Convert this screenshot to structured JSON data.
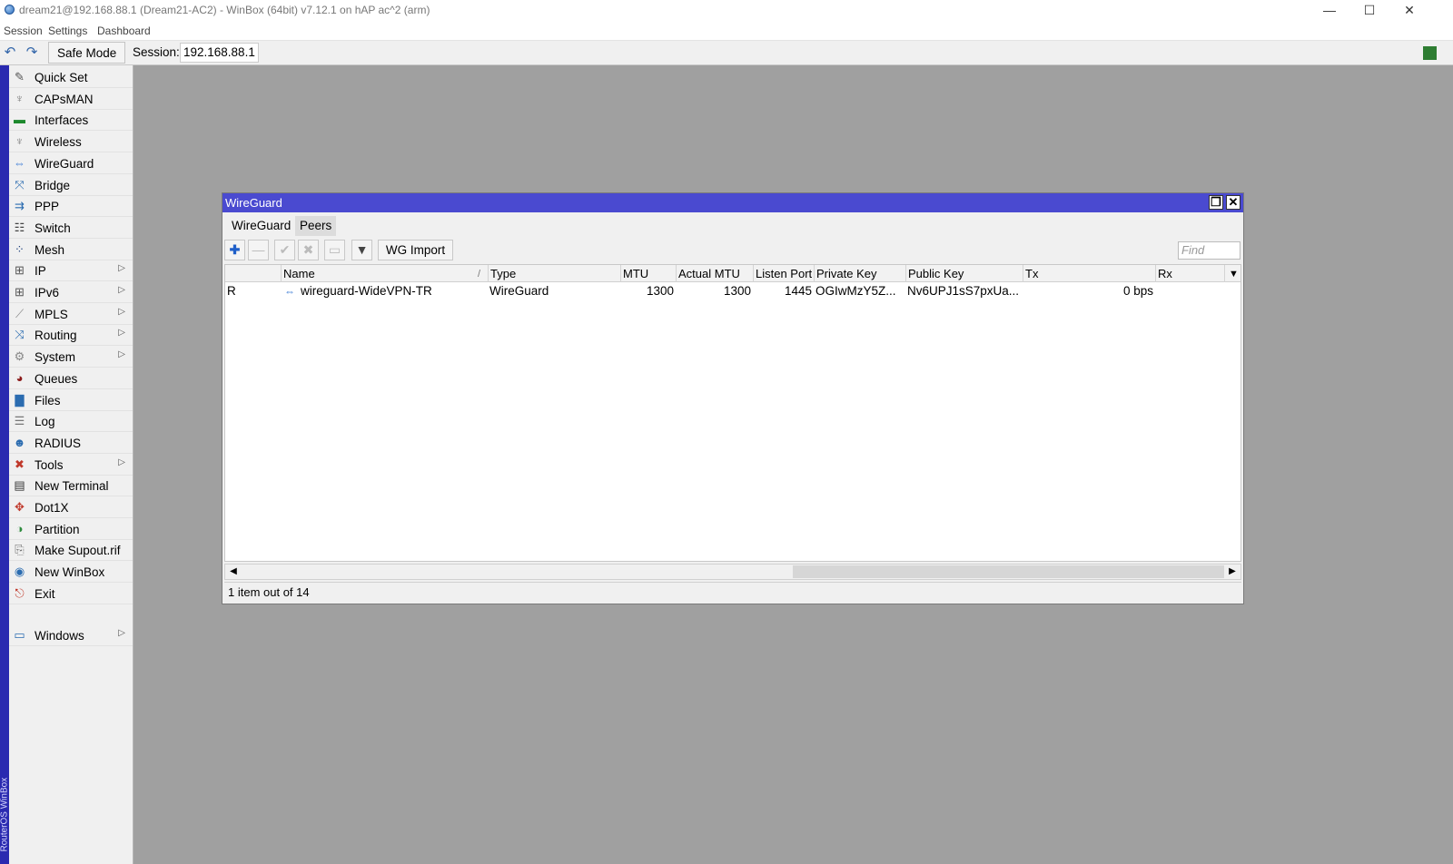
{
  "window": {
    "title": "dream21@192.168.88.1 (Dream21-AC2) - WinBox (64bit) v7.12.1 on hAP ac^2 (arm)",
    "controls": {
      "minimize": "—",
      "maximize": "☐",
      "close": "✕"
    }
  },
  "menubar": [
    "Session",
    "Settings",
    "Dashboard"
  ],
  "toolbar": {
    "undo_icon": "↶",
    "redo_icon": "↷",
    "safe_mode_label": "Safe Mode",
    "session_label": "Session:",
    "session_value": "192.168.88.1",
    "status_color": "#2e7d32"
  },
  "brand_strip": "RouterOS WinBox",
  "sidebar": {
    "items": [
      {
        "label": "Quick Set",
        "icon": "✎",
        "icon_name": "wand-icon",
        "color": "#555555",
        "submenu": false
      },
      {
        "label": "CAPsMAN",
        "icon": "♆",
        "icon_name": "antenna-icon",
        "color": "#777777",
        "submenu": false
      },
      {
        "label": "Interfaces",
        "icon": "▬",
        "icon_name": "interfaces-icon",
        "color": "#1e8a2e",
        "submenu": false
      },
      {
        "label": "Wireless",
        "icon": "♆",
        "icon_name": "wireless-icon",
        "color": "#777777",
        "submenu": false
      },
      {
        "label": "WireGuard",
        "icon": "⇔",
        "icon_name": "wireguard-icon",
        "color": "#3a7bd5",
        "submenu": false
      },
      {
        "label": "Bridge",
        "icon": "⤧",
        "icon_name": "bridge-icon",
        "color": "#2b6cb0",
        "submenu": false
      },
      {
        "label": "PPP",
        "icon": "⇉",
        "icon_name": "ppp-icon",
        "color": "#2b6cb0",
        "submenu": false
      },
      {
        "label": "Switch",
        "icon": "☷",
        "icon_name": "switch-icon",
        "color": "#444444",
        "submenu": false
      },
      {
        "label": "Mesh",
        "icon": "⁘",
        "icon_name": "mesh-icon",
        "color": "#1a3d7a",
        "submenu": false
      },
      {
        "label": "IP",
        "icon": "⊞",
        "icon_name": "ip-icon",
        "color": "#555555",
        "submenu": true
      },
      {
        "label": "IPv6",
        "icon": "⊞",
        "icon_name": "ipv6-icon",
        "color": "#555555",
        "submenu": true
      },
      {
        "label": "MPLS",
        "icon": "⟋",
        "icon_name": "mpls-icon",
        "color": "#888888",
        "submenu": true
      },
      {
        "label": "Routing",
        "icon": "⤨",
        "icon_name": "routing-icon",
        "color": "#2b6cb0",
        "submenu": true
      },
      {
        "label": "System",
        "icon": "⚙",
        "icon_name": "system-gear-icon",
        "color": "#888888",
        "submenu": true
      },
      {
        "label": "Queues",
        "icon": "◕",
        "icon_name": "queues-icon",
        "color": "#8b1a1a",
        "submenu": false
      },
      {
        "label": "Files",
        "icon": "▇",
        "icon_name": "folder-icon",
        "color": "#2b6cb0",
        "submenu": false
      },
      {
        "label": "Log",
        "icon": "☰",
        "icon_name": "log-icon",
        "color": "#777777",
        "submenu": false
      },
      {
        "label": "RADIUS",
        "icon": "☻",
        "icon_name": "radius-users-icon",
        "color": "#2b6cb0",
        "submenu": false
      },
      {
        "label": "Tools",
        "icon": "✖",
        "icon_name": "tools-icon",
        "color": "#c0392b",
        "submenu": true
      },
      {
        "label": "New Terminal",
        "icon": "▤",
        "icon_name": "terminal-icon",
        "color": "#333333",
        "submenu": false
      },
      {
        "label": "Dot1X",
        "icon": "✥",
        "icon_name": "dot1x-icon",
        "color": "#c0392b",
        "submenu": false
      },
      {
        "label": "Partition",
        "icon": "◑",
        "icon_name": "partition-icon",
        "color": "#2e8b3e",
        "submenu": false
      },
      {
        "label": "Make Supout.rif",
        "icon": "⎘",
        "icon_name": "supout-icon",
        "color": "#666666",
        "submenu": false
      },
      {
        "label": "New WinBox",
        "icon": "◉",
        "icon_name": "winbox-icon",
        "color": "#2b6cb0",
        "submenu": false
      },
      {
        "label": "Exit",
        "icon": "⎋",
        "icon_name": "exit-icon",
        "color": "#c0392b",
        "submenu": false
      }
    ],
    "windows_item": {
      "label": "Windows",
      "icon": "▭",
      "icon_name": "windows-icon",
      "color": "#2b6cb0",
      "submenu": true
    },
    "submenu_arrow": "▷"
  },
  "wg_window": {
    "title": "WireGuard",
    "restore_icon": "❐",
    "close_icon": "✕",
    "tabs": [
      "WireGuard",
      "Peers"
    ],
    "buttons": {
      "add": "✚",
      "remove": "—",
      "enable": "✔",
      "disable": "✖",
      "comment": "▭",
      "filter": "▼",
      "import_label": "WG Import"
    },
    "find_placeholder": "Find",
    "columns": [
      "",
      "Name",
      "Type",
      "MTU",
      "Actual MTU",
      "Listen Port",
      "Private Key",
      "Public Key",
      "Tx",
      "Rx"
    ],
    "sort_mark": "/",
    "rows": [
      {
        "flag": "R",
        "name": "wireguard-WideVPN-TR",
        "type": "WireGuard",
        "mtu": "1300",
        "actual_mtu": "1300",
        "listen_port": "1445",
        "private_key": "OGIwMzY5Z...",
        "public_key": "Nv6UPJ1sS7pxUa...",
        "tx": "0 bps",
        "rx": ""
      }
    ],
    "status": "1 item out of 14"
  }
}
